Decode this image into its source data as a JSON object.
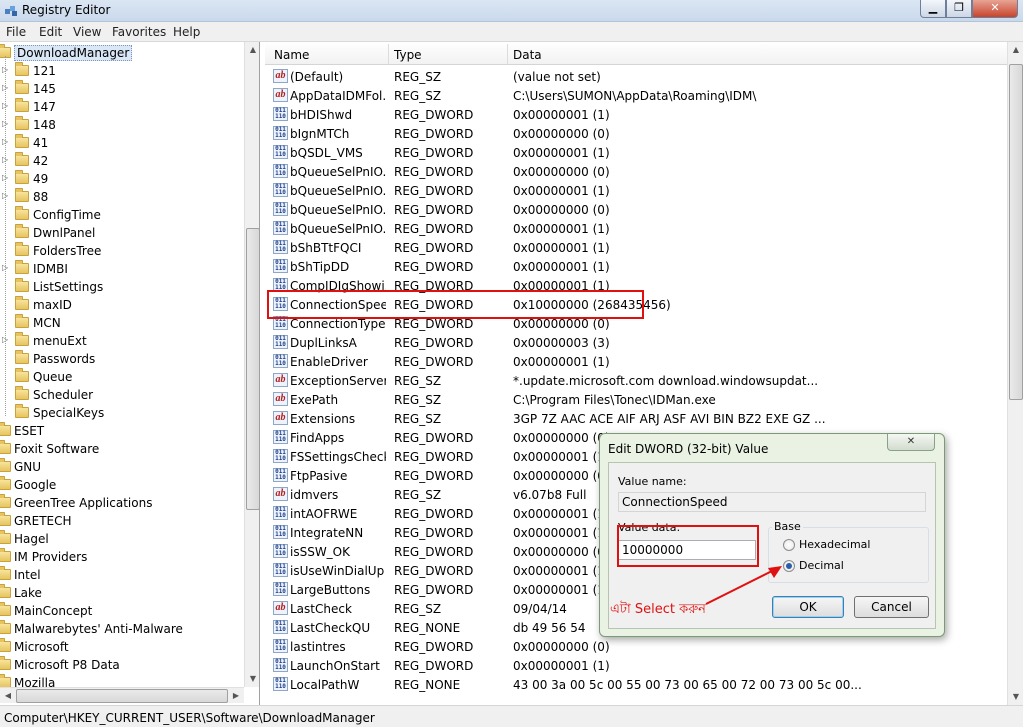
{
  "window": {
    "title": "Registry Editor",
    "min_label": "▁",
    "max_label": "❐",
    "close_label": "✕"
  },
  "menu": [
    "File",
    "Edit",
    "View",
    "Favorites",
    "Help"
  ],
  "tree": {
    "root": "DownloadManager",
    "children": [
      "121",
      "145",
      "147",
      "148",
      "41",
      "42",
      "49",
      "88",
      "ConfigTime",
      "DwnlPanel",
      "FoldersTree",
      "IDMBI",
      "ListSettings",
      "maxID",
      "MCN",
      "menuExt",
      "Passwords",
      "Queue",
      "Scheduler",
      "SpecialKeys"
    ],
    "children_expandable": [
      true,
      true,
      true,
      true,
      true,
      true,
      true,
      true,
      false,
      false,
      false,
      true,
      false,
      false,
      false,
      true,
      false,
      false,
      false,
      false
    ],
    "siblings": [
      "ESET",
      "Foxit Software",
      "GNU",
      "Google",
      "GreenTree Applications",
      "GRETECH",
      "Hagel",
      "IM Providers",
      "Intel",
      "Lake",
      "MainConcept",
      "Malwarebytes' Anti-Malware",
      "Microsoft",
      "Microsoft P8 Data",
      "Mozilla"
    ]
  },
  "columns": {
    "name": "Name",
    "type": "Type",
    "data": "Data"
  },
  "values": [
    {
      "name": "(Default)",
      "type": "REG_SZ",
      "data": "(value not set)",
      "icon": "sz"
    },
    {
      "name": "AppDataIDMFol...",
      "type": "REG_SZ",
      "data": "C:\\Users\\SUMON\\AppData\\Roaming\\IDM\\",
      "icon": "sz"
    },
    {
      "name": "bHDIShwd",
      "type": "REG_DWORD",
      "data": "0x00000001 (1)",
      "icon": "bin"
    },
    {
      "name": "bIgnMTCh",
      "type": "REG_DWORD",
      "data": "0x00000000 (0)",
      "icon": "bin"
    },
    {
      "name": "bQSDL_VMS",
      "type": "REG_DWORD",
      "data": "0x00000001 (1)",
      "icon": "bin"
    },
    {
      "name": "bQueueSelPnIO...",
      "type": "REG_DWORD",
      "data": "0x00000000 (0)",
      "icon": "bin"
    },
    {
      "name": "bQueueSelPnIO...",
      "type": "REG_DWORD",
      "data": "0x00000001 (1)",
      "icon": "bin"
    },
    {
      "name": "bQueueSelPnIO...",
      "type": "REG_DWORD",
      "data": "0x00000000 (0)",
      "icon": "bin"
    },
    {
      "name": "bQueueSelPnIO...",
      "type": "REG_DWORD",
      "data": "0x00000001 (1)",
      "icon": "bin"
    },
    {
      "name": "bShBTtFQCI",
      "type": "REG_DWORD",
      "data": "0x00000001 (1)",
      "icon": "bin"
    },
    {
      "name": "bShTipDD",
      "type": "REG_DWORD",
      "data": "0x00000001 (1)",
      "icon": "bin"
    },
    {
      "name": "CompIDIgShowi...",
      "type": "REG_DWORD",
      "data": "0x00000001 (1)",
      "icon": "bin"
    },
    {
      "name": "ConnectionSpeed",
      "type": "REG_DWORD",
      "data": "0x10000000 (268435456)",
      "icon": "bin"
    },
    {
      "name": "ConnectionType",
      "type": "REG_DWORD",
      "data": "0x00000000 (0)",
      "icon": "bin"
    },
    {
      "name": "DuplLinksA",
      "type": "REG_DWORD",
      "data": "0x00000003 (3)",
      "icon": "bin"
    },
    {
      "name": "EnableDriver",
      "type": "REG_DWORD",
      "data": "0x00000001 (1)",
      "icon": "bin"
    },
    {
      "name": "ExceptionServers",
      "type": "REG_SZ",
      "data": "*.update.microsoft.com download.windowsupdat...",
      "icon": "sz"
    },
    {
      "name": "ExePath",
      "type": "REG_SZ",
      "data": "C:\\Program Files\\Tonec\\IDMan.exe",
      "icon": "sz"
    },
    {
      "name": "Extensions",
      "type": "REG_SZ",
      "data": "3GP 7Z AAC ACE AIF ARJ ASF AVI BIN BZ2 EXE GZ ...",
      "icon": "sz"
    },
    {
      "name": "FindApps",
      "type": "REG_DWORD",
      "data": "0x00000000 (0)",
      "icon": "bin"
    },
    {
      "name": "FSSettingsCheck...",
      "type": "REG_DWORD",
      "data": "0x00000001 (1)",
      "icon": "bin"
    },
    {
      "name": "FtpPasive",
      "type": "REG_DWORD",
      "data": "0x00000000 (0)",
      "icon": "bin"
    },
    {
      "name": "idmvers",
      "type": "REG_SZ",
      "data": "v6.07b8 Full",
      "icon": "sz"
    },
    {
      "name": "intAOFRWE",
      "type": "REG_DWORD",
      "data": "0x00000001 (1)",
      "icon": "bin"
    },
    {
      "name": "IntegrateNN",
      "type": "REG_DWORD",
      "data": "0x00000001 (1)",
      "icon": "bin"
    },
    {
      "name": "isSSW_OK",
      "type": "REG_DWORD",
      "data": "0x00000000 (0)",
      "icon": "bin"
    },
    {
      "name": "isUseWinDialUp",
      "type": "REG_DWORD",
      "data": "0x00000001 (1)",
      "icon": "bin"
    },
    {
      "name": "LargeButtons",
      "type": "REG_DWORD",
      "data": "0x00000001 (1)",
      "icon": "bin"
    },
    {
      "name": "LastCheck",
      "type": "REG_SZ",
      "data": "09/04/14",
      "icon": "sz"
    },
    {
      "name": "LastCheckQU",
      "type": "REG_NONE",
      "data": "db 49 56 54",
      "icon": "bin"
    },
    {
      "name": "lastintres",
      "type": "REG_DWORD",
      "data": "0x00000000 (0)",
      "icon": "bin"
    },
    {
      "name": "LaunchOnStart",
      "type": "REG_DWORD",
      "data": "0x00000001 (1)",
      "icon": "bin"
    },
    {
      "name": "LocalPathW",
      "type": "REG_NONE",
      "data": "43 00 3a 00 5c 00 55 00 73 00 65 00 72 00 73 00 5c 00...",
      "icon": "bin"
    }
  ],
  "icons": {
    "sz": "ab",
    "bin": "011\n110"
  },
  "status": {
    "path": "Computer\\HKEY_CURRENT_USER\\Software\\DownloadManager"
  },
  "dialog": {
    "title": "Edit DWORD (32-bit) Value",
    "close_label": "✕",
    "value_name_label": "Value name:",
    "value_name": "ConnectionSpeed",
    "value_data_label": "Value data:",
    "value_data": "10000000",
    "base_label": "Base",
    "hex_label": "Hexadecimal",
    "dec_label": "Decimal",
    "base_selected": "Decimal",
    "ok_label": "OK",
    "cancel_label": "Cancel"
  },
  "annotation": {
    "text": "এটা  Select করুন",
    "color": "#e01010"
  }
}
